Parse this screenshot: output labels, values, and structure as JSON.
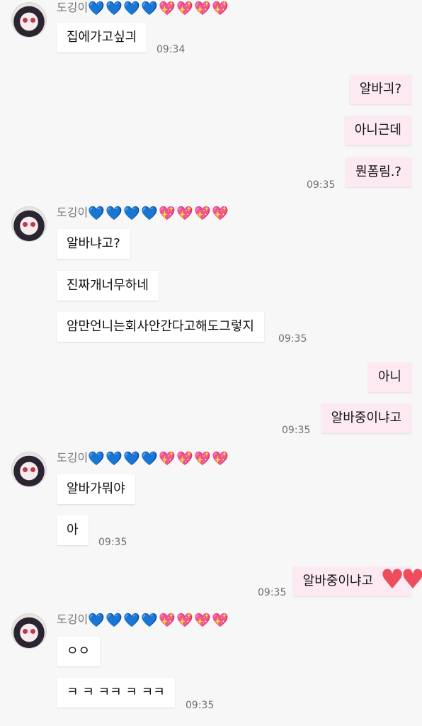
{
  "sender": {
    "name": "도깅이"
  },
  "heart_colors": {
    "blue": "#1a73e8",
    "pink": "#ef3f83"
  },
  "hearts": [
    "💙",
    "💙",
    "💙",
    "💙",
    "💖",
    "💖",
    "💖",
    "💖"
  ],
  "groups": [
    {
      "type": "incoming",
      "messages": [
        "집에가고싶긔"
      ],
      "time": "09:34"
    },
    {
      "type": "outgoing",
      "messages": [
        "알바긔?",
        "아니근데",
        "뭔폼림.?"
      ],
      "time": "09:35"
    },
    {
      "type": "incoming",
      "messages": [
        "알바냐고?",
        "진짜개너무하네",
        "암만언니는회사안간다고해도그렇지"
      ],
      "time": "09:35"
    },
    {
      "type": "outgoing",
      "messages": [
        "아니",
        "알바중이냐고"
      ],
      "time": "09:35"
    },
    {
      "type": "incoming",
      "messages": [
        "알바가뭐야",
        "아"
      ],
      "time": "09:35"
    },
    {
      "type": "outgoing",
      "messages": [
        "알바중이냐고"
      ],
      "time": "09:35",
      "sticker": "heart-sticker"
    },
    {
      "type": "incoming",
      "messages": [
        "ㅇㅇ",
        "ㅋ ㅋ ㅋㅋ ㅋ ㅋㅋ"
      ],
      "time": "09:35"
    }
  ]
}
